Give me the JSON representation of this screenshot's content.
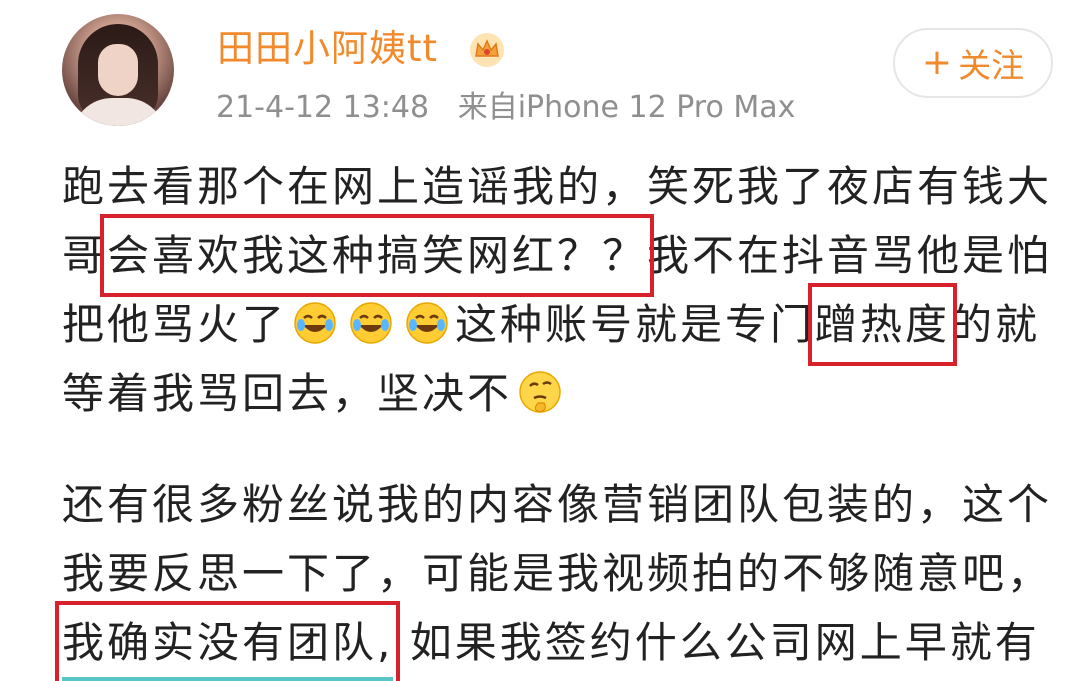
{
  "post": {
    "username": "田田小阿姨tt",
    "timestamp": "21-4-12 13:48",
    "source": "来自iPhone 12 Pro Max",
    "follow_label": "关注",
    "follow_icon": "plus-icon",
    "badge_icon": "crown-icon",
    "paragraph1": {
      "s1": "跑去看那个在网上造谣我的，笑死我了夜店有钱大哥",
      "h1": "会喜欢我这种搞笑网红？？",
      "s2": "我不在抖音骂他是怕把他骂火了",
      "s3": "这种账号就是专门",
      "h2": "蹭热度",
      "s4": "的就等着我骂回去，坚决不"
    },
    "paragraph2": {
      "s1": "还有很多粉丝说我的内容像营销团队包装的，这个我要反思一下了，可能是我视频拍的不够随意吧，",
      "h1": "我确实没有团队,",
      "s2": " 如果我签约什么公司网上早就有"
    },
    "colors": {
      "username": "#f08a2c",
      "highlight_box": "#d8222b",
      "meta": "#8f8f8f"
    }
  }
}
